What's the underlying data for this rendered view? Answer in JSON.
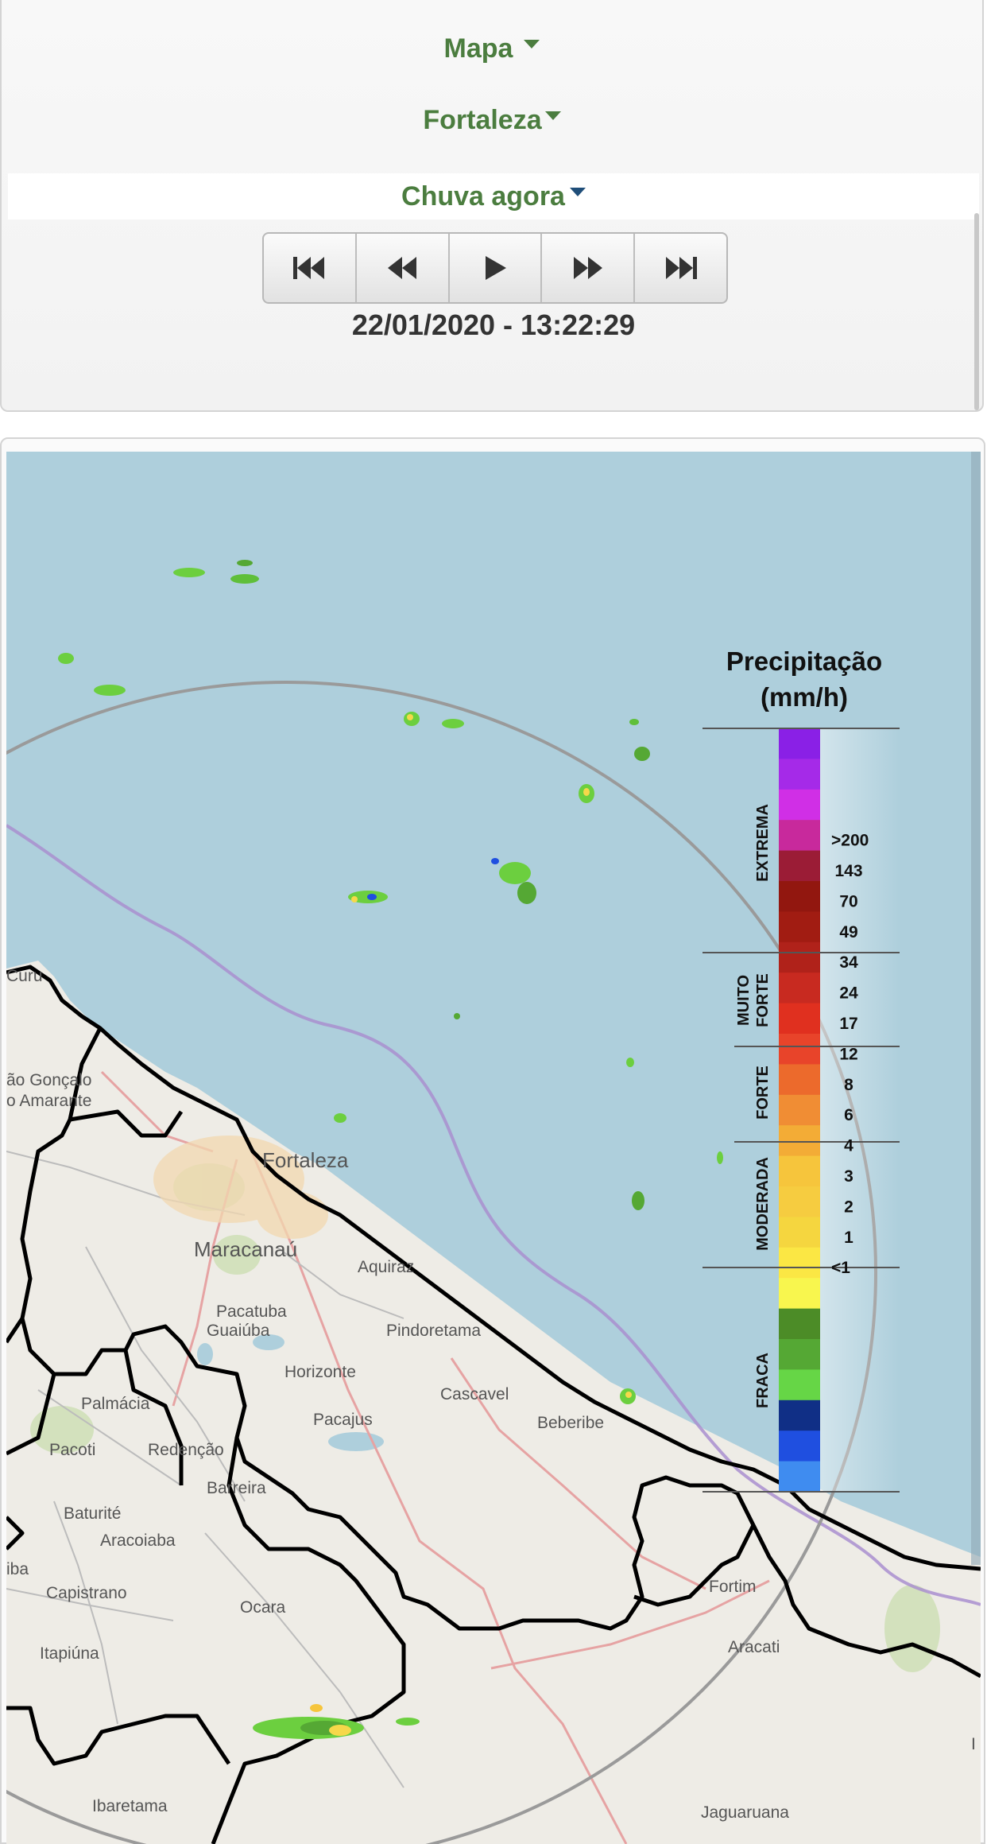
{
  "menu": {
    "map_label": "Mapa",
    "city_label": "Fortaleza",
    "product_label": "Chuva agora"
  },
  "player": {
    "buttons": [
      {
        "name": "first-frame",
        "icon": "skip-first-icon"
      },
      {
        "name": "previous-frame",
        "icon": "rewind-icon"
      },
      {
        "name": "play",
        "icon": "play-icon"
      },
      {
        "name": "next-frame",
        "icon": "fast-forward-icon"
      },
      {
        "name": "last-frame",
        "icon": "skip-last-icon"
      }
    ],
    "timestamp": "22/01/2020 - 13:22:29"
  },
  "map": {
    "place_labels": {
      "curu": "Curu",
      "sao_goncalo": "ão Gonçalo",
      "amarante": "o Amarante",
      "fortaleza": "Fortaleza",
      "maracanau": "Maracanaú",
      "aquiraz": "Aquiraz",
      "pacatuba": "Pacatuba",
      "guaiuba": "Guaiúba",
      "pindoretama": "Pindoretama",
      "horizonte": "Horizonte",
      "cascavel": "Cascavel",
      "palmacia": "Palmácia",
      "pacajus": "Pacajus",
      "beberibe": "Beberibe",
      "pacoti": "Pacoti",
      "redencao": "Redenção",
      "barreira": "Barreira",
      "baturite": "Baturité",
      "aracoiaba": "Aracoiaba",
      "iba": "iba",
      "capistrano": "Capistrano",
      "ocara": "Ocara",
      "itapiuna": "Itapiúna",
      "fortim": "Fortim",
      "aracati": "Aracati",
      "ibaretama": "Ibaretama",
      "jaguaruana": "Jaguaruana",
      "edge_i": "I"
    },
    "colors": {
      "ocean": "#aecfdc",
      "land": "#eeece6",
      "border": "#000000",
      "radar_ring": "#9a9a9a",
      "coast_contour": "#a98fcf"
    }
  },
  "legend": {
    "title_line1": "Precipitação",
    "title_line2": "(mm/h)",
    "categories": [
      "EXTREMA",
      "MUITO",
      "FORTE",
      "FORTE",
      "MODERADA",
      "FRACA"
    ],
    "values": [
      ">200",
      "143",
      "70",
      "49",
      "34",
      "24",
      "17",
      "12",
      "8",
      "6",
      "4",
      "3",
      "2",
      "1",
      "<1"
    ],
    "swatch_colors": [
      "#8a20e6",
      "#a52ae8",
      "#d02fe6",
      "#c8299c",
      "#9b1c36",
      "#92170f",
      "#a11c12",
      "#b0221a",
      "#c82a20",
      "#e0301f",
      "#e8442a",
      "#ec6a2c",
      "#f08d34",
      "#f3ac36",
      "#f6c53c",
      "#f6cc40",
      "#f5d63f",
      "#fbe744",
      "#f8f64e",
      "#4c8c27",
      "#55a834",
      "#66d646",
      "#102f86",
      "#1f4fe0",
      "#3f8cf0"
    ]
  }
}
